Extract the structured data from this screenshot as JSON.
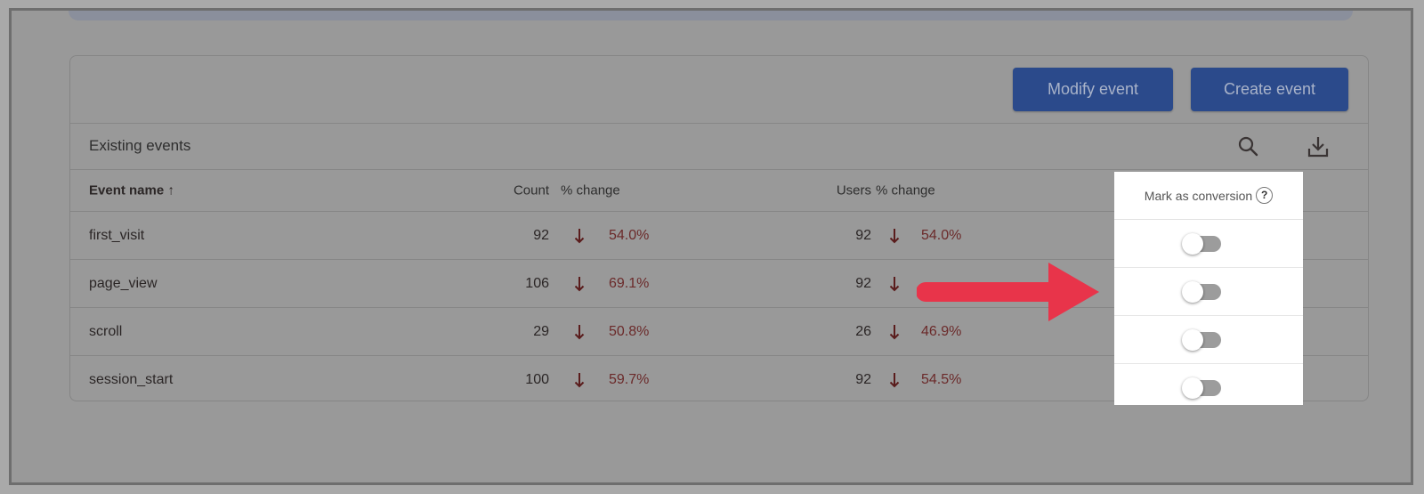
{
  "toolbar": {
    "modify_label": "Modify event",
    "create_label": "Create event"
  },
  "section": {
    "title": "Existing events",
    "icons": [
      "search-icon",
      "download-icon"
    ]
  },
  "table": {
    "columns": {
      "name": "Event name",
      "sort_indicator": "↑",
      "count": "Count",
      "count_change": "% change",
      "users": "Users",
      "users_change": "% change"
    },
    "rows": [
      {
        "name": "first_visit",
        "count": "92",
        "count_change": "54.0%",
        "users": "92",
        "users_change": "54.0%",
        "conversion": false
      },
      {
        "name": "page_view",
        "count": "106",
        "count_change": "69.1%",
        "users": "92",
        "users_change": "",
        "conversion": false
      },
      {
        "name": "scroll",
        "count": "29",
        "count_change": "50.8%",
        "users": "26",
        "users_change": "46.9%",
        "conversion": false
      },
      {
        "name": "session_start",
        "count": "100",
        "count_change": "59.7%",
        "users": "92",
        "users_change": "54.5%",
        "conversion": false
      }
    ],
    "trend_direction": "down",
    "trend_color": "#6b2a2a"
  },
  "conversion_panel": {
    "header": "Mark as conversion",
    "help_glyph": "?"
  },
  "annotation": {
    "arrow_color": "#e8344a",
    "points_to": "Mark as conversion toggles"
  },
  "colors": {
    "button_bg": "#2b4a8b",
    "overlay": "#999999"
  }
}
